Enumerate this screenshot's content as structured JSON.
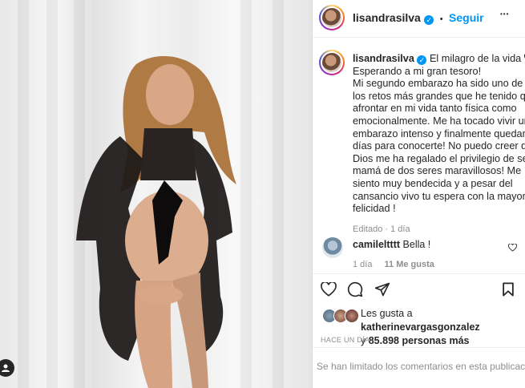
{
  "post": {
    "username": "lisandrasilva",
    "follow_label": "Seguir",
    "separator": "•",
    "more_label": "•••"
  },
  "caption": {
    "username": "lisandrasilva",
    "lines": [
      "El milagro de la vida",
      "Esperando a mi gran tesoro!",
      "Mi segundo embarazo ha sido uno de",
      "los retos más grandes que he tenido que",
      "afrontar en mi vida tanto física como",
      "emocionalmente. Me ha tocado vivir un",
      "embarazo intenso y finalmente quedan",
      "días para conocerte! No puedo creer que",
      "Dios me ha regalado el privilegio de ser",
      "mamá de dos seres maravillosos! Me",
      "siento muy bendecida y a pesar del",
      "cansancio vivo tu espera con la mayor",
      "felicidad !"
    ],
    "edited_label": "Editado",
    "edited_time": "1 día"
  },
  "comment": {
    "username": "camileltttt",
    "text": "Bella !",
    "time": "1 día",
    "likes": "11 Me gusta"
  },
  "likes": {
    "prefix": "Les gusta a",
    "user": "katherinevargasgonzalez",
    "and": "y",
    "count": "85.898 personas más"
  },
  "timestamp": "HACE UN DÍA",
  "comments_limited": "Se han limitado los comentarios en esta publicación.",
  "colors": {
    "accent": "#0095f6",
    "text": "#262626",
    "muted": "#8e8e8e",
    "border": "#dbdbdb"
  }
}
